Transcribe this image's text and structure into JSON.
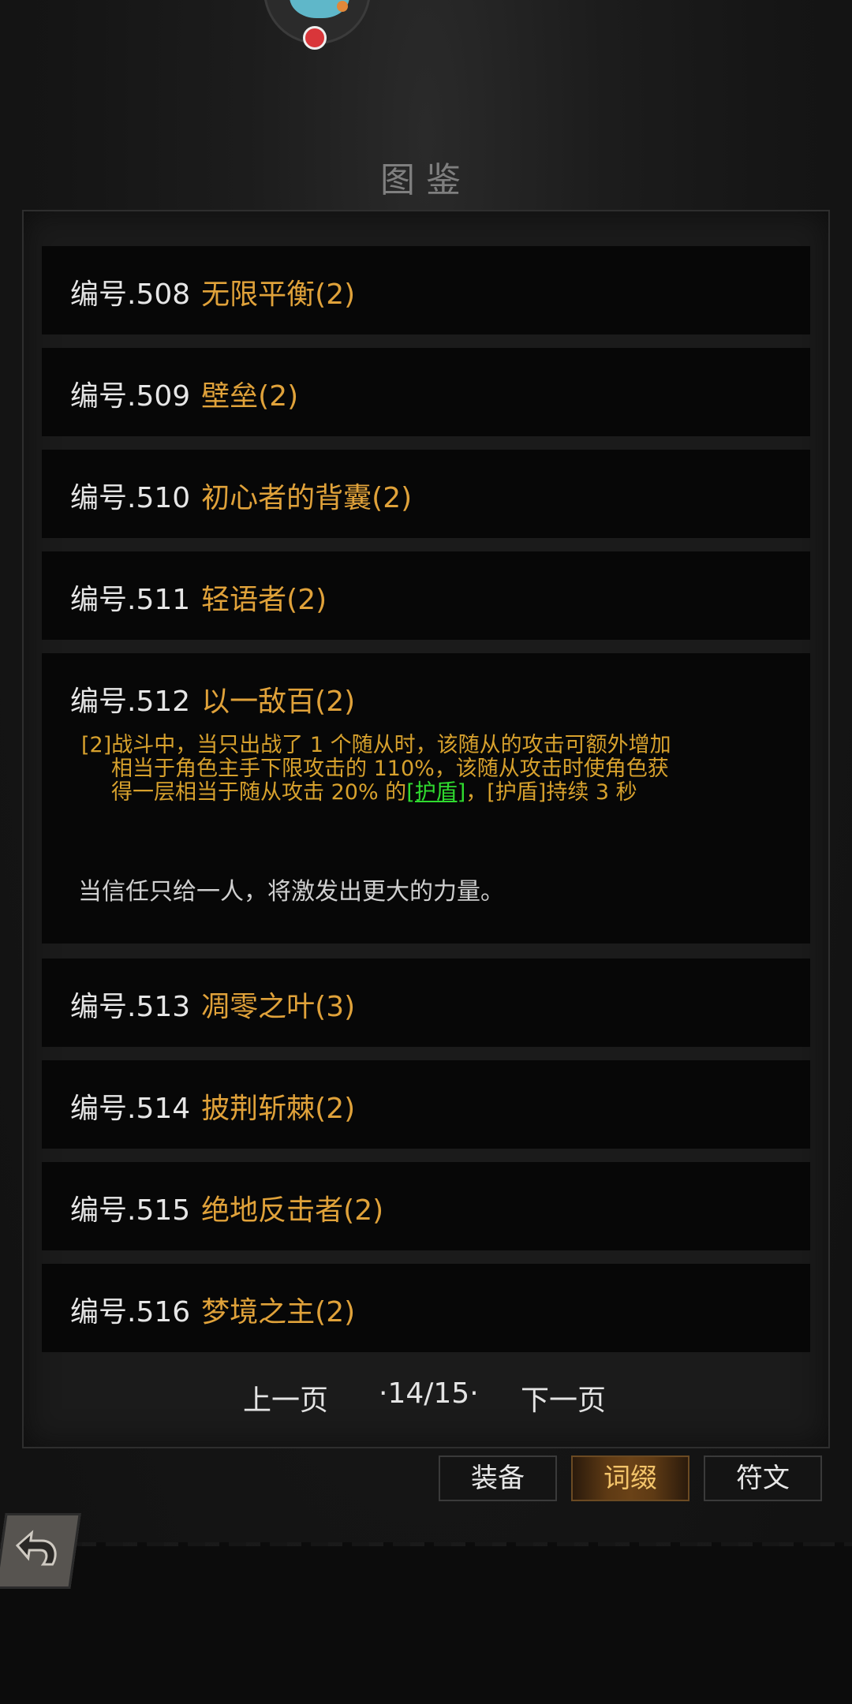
{
  "header": {
    "title": "图鉴"
  },
  "entries": [
    {
      "num": "编号.508",
      "name": "无限平衡(2)"
    },
    {
      "num": "编号.509",
      "name": "壁垒(2)"
    },
    {
      "num": "编号.510",
      "name": "初心者的背囊(2)"
    },
    {
      "num": "编号.511",
      "name": "轻语者(2)"
    },
    {
      "num": "编号.512",
      "name": "以一敌百(2)"
    },
    {
      "num": "编号.513",
      "name": "凋零之叶(3)"
    },
    {
      "num": "编号.514",
      "name": "披荆斩棘(2)"
    },
    {
      "num": "编号.515",
      "name": "绝地反击者(2)"
    },
    {
      "num": "编号.516",
      "name": "梦境之主(2)"
    }
  ],
  "expanded": {
    "desc_line1": "[2]战斗中，当只出战了 1 个随从时，该随从的攻击可额外增加",
    "desc_line2": "相当于角色主手下限攻击的 110%，该随从攻击时使角色获",
    "desc_line3_a": "得一层相当于随从攻击 20% 的",
    "desc_line3_link": "[护盾]",
    "desc_line3_b": "，[护盾]持续 3 秒",
    "flavor": "当信任只给一人，将激发出更大的力量。"
  },
  "pager": {
    "prev": "上一页",
    "page": "·14/15·",
    "next": "下一页"
  },
  "tabs": {
    "equipment": "装备",
    "affix": "词缀",
    "rune": "符文"
  },
  "colors": {
    "name": "#e0a23a",
    "desc": "#d7a12d",
    "link": "#2fdb2f",
    "active_tab": "#6a4217"
  },
  "icons": {
    "back": "back-arrow-icon",
    "avatar": "pet-avatar"
  }
}
